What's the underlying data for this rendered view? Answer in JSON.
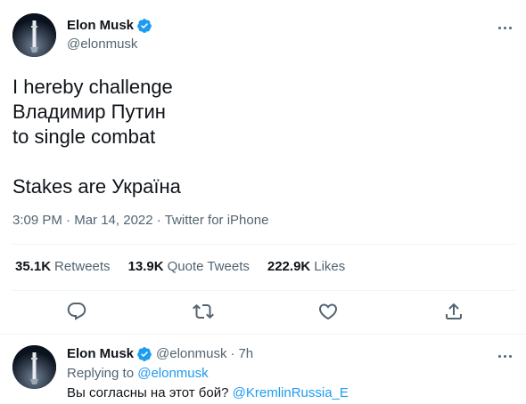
{
  "tweet": {
    "display_name": "Elon Musk",
    "handle": "@elonmusk",
    "text": "I hereby challenge\nВладимир Путин\nto single combat\n\nStakes are Україна",
    "time": "3:09 PM",
    "date": "Mar 14, 2022",
    "source": "Twitter for iPhone",
    "meta_separator": "·",
    "stats": {
      "retweets_count": "35.1K",
      "retweets_label": "Retweets",
      "quotes_count": "13.9K",
      "quotes_label": "Quote Tweets",
      "likes_count": "222.9K",
      "likes_label": "Likes"
    }
  },
  "reply": {
    "display_name": "Elon Musk",
    "handle": "@elonmusk",
    "separator": "·",
    "age": "7h",
    "replying_prefix": "Replying to",
    "replying_to": "@elonmusk",
    "text": "Вы согласны на этот бой?",
    "mention": "@KremlinRussia_E"
  },
  "colors": {
    "accent": "#1d9bf0",
    "secondary_text": "#536471",
    "divider": "#eff3f4"
  },
  "icons": [
    "verified-badge-icon",
    "more-options-icon",
    "reply-icon",
    "retweet-icon",
    "like-icon",
    "share-icon"
  ]
}
